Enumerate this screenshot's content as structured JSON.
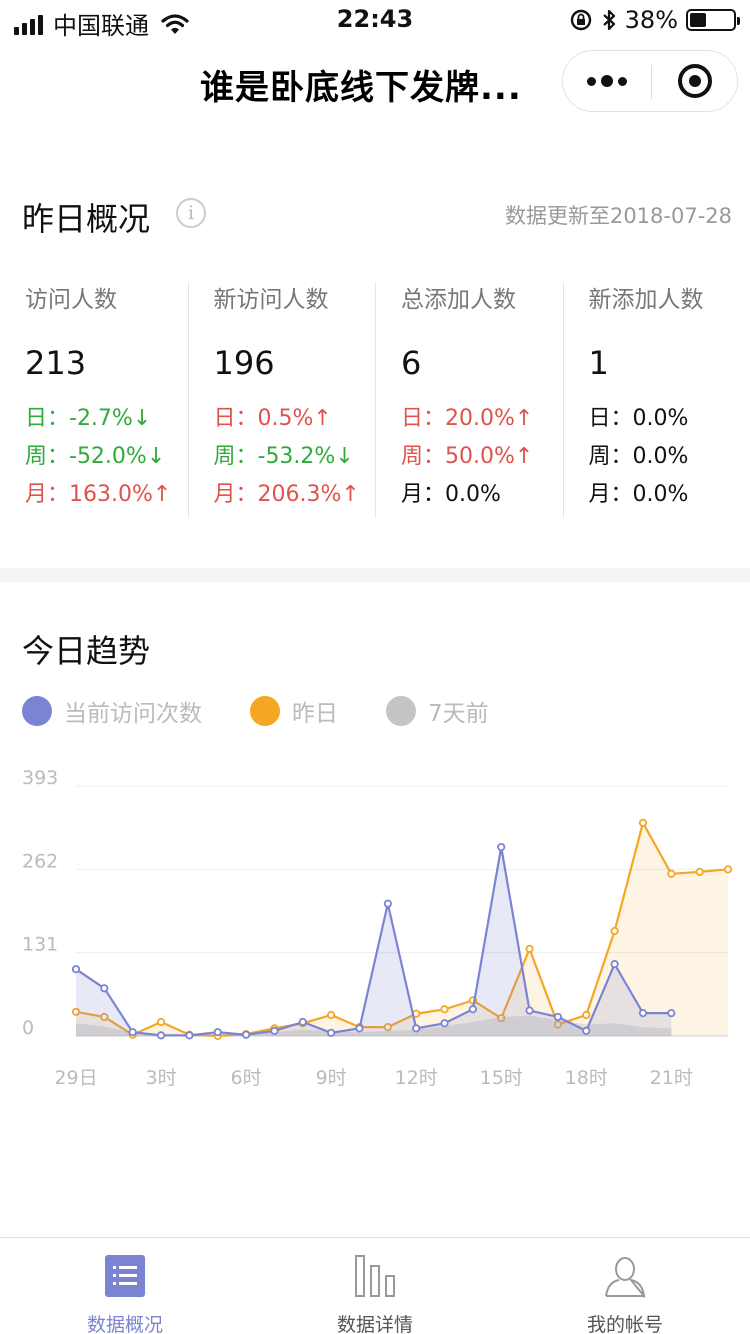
{
  "status_bar": {
    "carrier": "中国联通",
    "time": "22:43",
    "battery_percent": "38%",
    "battery_level": 0.38
  },
  "nav": {
    "title": "谁是卧底线下发牌..."
  },
  "overview": {
    "title": "昨日概况",
    "info_glyph": "i",
    "update_text": "数据更新至2018-07-28",
    "metrics": [
      {
        "label": "访问人数",
        "value": "213",
        "rows": [
          {
            "text": "日：-2.7%↓",
            "trend": "down"
          },
          {
            "text": "周：-52.0%↓",
            "trend": "down"
          },
          {
            "text": "月：163.0%↑",
            "trend": "up"
          }
        ]
      },
      {
        "label": "新访问人数",
        "value": "196",
        "rows": [
          {
            "text": "日：0.5%↑",
            "trend": "up"
          },
          {
            "text": "周：-53.2%↓",
            "trend": "down"
          },
          {
            "text": "月：206.3%↑",
            "trend": "up"
          }
        ]
      },
      {
        "label": "总添加人数",
        "value": "6",
        "rows": [
          {
            "text": "日：20.0%↑",
            "trend": "up"
          },
          {
            "text": "周：50.0%↑",
            "trend": "up"
          },
          {
            "text": "月：0.0%",
            "trend": "flat"
          }
        ]
      },
      {
        "label": "新添加人数",
        "value": "1",
        "rows": [
          {
            "text": "日：0.0%",
            "trend": "flat"
          },
          {
            "text": "周：0.0%",
            "trend": "flat"
          },
          {
            "text": "月：0.0%",
            "trend": "flat"
          }
        ]
      }
    ]
  },
  "trend": {
    "title": "今日趋势",
    "legend": [
      {
        "label": "当前访问次数",
        "color": "#7b84d3"
      },
      {
        "label": "昨日",
        "color": "#f5a623"
      },
      {
        "label": "7天前",
        "color": "#c4c4c4"
      }
    ]
  },
  "chart_data": {
    "type": "line",
    "ylim": [
      0,
      393
    ],
    "y_ticks": [
      "393",
      "262",
      "131",
      "0"
    ],
    "x_tick_labels": [
      "29日",
      "3时",
      "6时",
      "9时",
      "12时",
      "15时",
      "18时",
      "21时"
    ],
    "series": [
      {
        "name": "当前访问次数",
        "color": "#7b84d3",
        "values": [
          105,
          75,
          6,
          1,
          1,
          6,
          2,
          8,
          22,
          5,
          12,
          208,
          12,
          20,
          42,
          297,
          40,
          30,
          8,
          113,
          36,
          36
        ]
      },
      {
        "name": "昨日",
        "color": "#f5a623",
        "values": [
          38,
          30,
          2,
          22,
          2,
          0,
          3,
          12,
          20,
          33,
          14,
          14,
          35,
          42,
          56,
          28,
          137,
          18,
          33,
          165,
          335,
          255,
          258,
          262
        ]
      },
      {
        "name": "7天前",
        "color": "#c4c4c4",
        "values": [
          20,
          15,
          5,
          2,
          1,
          2,
          3,
          6,
          10,
          8,
          6,
          8,
          10,
          15,
          22,
          30,
          32,
          25,
          18,
          20,
          14,
          12
        ]
      }
    ]
  },
  "tabbar": {
    "tabs": [
      {
        "label": "数据概况",
        "active": true
      },
      {
        "label": "数据详情",
        "active": false
      },
      {
        "label": "我的帐号",
        "active": false
      }
    ]
  }
}
